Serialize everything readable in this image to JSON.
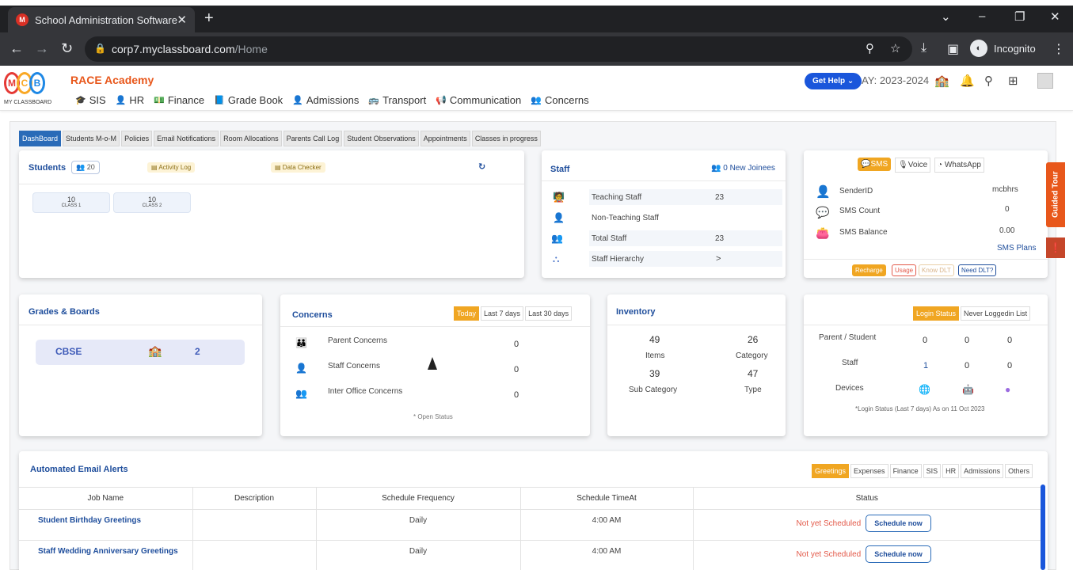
{
  "browser": {
    "tab_title": "School Administration Software",
    "url_host": "corp7.myclassboard.com",
    "url_path": "/Home",
    "incognito_label": "Incognito"
  },
  "app": {
    "school_name": "RACE Academy",
    "logo_letters": [
      "M",
      "C",
      "B"
    ],
    "logo_caption": "MY CLASSBOARD",
    "nav": [
      {
        "label": "SIS",
        "icon": "graduation-cap-icon"
      },
      {
        "label": "HR",
        "icon": "person-icon"
      },
      {
        "label": "Finance",
        "icon": "money-icon"
      },
      {
        "label": "Grade Book",
        "icon": "book-icon"
      },
      {
        "label": "Admissions",
        "icon": "person-icon"
      },
      {
        "label": "Transport",
        "icon": "bus-icon"
      },
      {
        "label": "Communication",
        "icon": "megaphone-icon"
      },
      {
        "label": "Concerns",
        "icon": "people-icon"
      }
    ],
    "get_help": "Get Help",
    "academic_year": "AY: 2023-2024"
  },
  "subtabs": [
    "DashBoard",
    "Students M-o-M",
    "Policies",
    "Email Notifications",
    "Room Allocations",
    "Parents Call Log",
    "Student Observations",
    "Appointments",
    "Classes in progress"
  ],
  "students": {
    "title": "Students",
    "count": "20",
    "activity_log": "Activity Log",
    "data_checker": "Data Checker",
    "classes": [
      {
        "count": "10",
        "name": "CLASS 1"
      },
      {
        "count": "10",
        "name": "CLASS 2"
      }
    ]
  },
  "staff": {
    "title": "Staff",
    "new_joinees": "0 New Joinees",
    "rows": [
      {
        "label": "Teaching Staff",
        "value": "23"
      },
      {
        "label": "Non-Teaching Staff",
        "value": ""
      },
      {
        "label": "Total Staff",
        "value": "23"
      },
      {
        "label": "Staff Hierarchy",
        "value": ">"
      }
    ]
  },
  "sms": {
    "channels": [
      "SMS",
      "Voice",
      "WhatsApp"
    ],
    "rows": [
      {
        "label": "SenderID",
        "value": "mcbhrs"
      },
      {
        "label": "SMS Count",
        "value": "0"
      },
      {
        "label": "SMS Balance",
        "value": "0.00"
      }
    ],
    "plans_link": "SMS Plans",
    "actions": [
      "Recharge",
      "Usage",
      "Know DLT",
      "Need DLT?"
    ]
  },
  "guided_tour": "Guided Tour",
  "grades": {
    "title": "Grades & Boards",
    "board": "CBSE",
    "count": "2"
  },
  "concerns": {
    "title": "Concerns",
    "ranges": [
      "Today",
      "Last 7 days",
      "Last 30 days"
    ],
    "rows": [
      {
        "label": "Parent Concerns",
        "value": "0"
      },
      {
        "label": "Staff Concerns",
        "value": "0"
      },
      {
        "label": "Inter Office Concerns",
        "value": "0"
      }
    ],
    "footnote": "* Open Status"
  },
  "inventory": {
    "title": "Inventory",
    "items_value": "49",
    "items_label": "Items",
    "category_value": "26",
    "category_label": "Category",
    "subcat_value": "39",
    "subcat_label": "Sub Category",
    "type_value": "47",
    "type_label": "Type"
  },
  "login": {
    "toggles": [
      "Login Status",
      "Never Loggedin List"
    ],
    "rows": [
      {
        "label": "Parent / Student",
        "values": [
          "0",
          "0",
          "0"
        ]
      },
      {
        "label": "Staff",
        "values": [
          "1",
          "0",
          "0"
        ]
      }
    ],
    "devices_label": "Devices",
    "footnote": "*Login Status (Last 7 days) As on 11 Oct 2023"
  },
  "email_alerts": {
    "title": "Automated Email Alerts",
    "filters": [
      "Greetings",
      "Expenses",
      "Finance",
      "SIS",
      "HR",
      "Admissions",
      "Others"
    ],
    "headers": [
      "Job Name",
      "Description",
      "Schedule Frequency",
      "Schedule TimeAt",
      "Status"
    ],
    "rows": [
      {
        "job": "Student Birthday Greetings",
        "description": "",
        "frequency": "Daily",
        "time": "4:00 AM",
        "status": "Not yet Scheduled",
        "action": "Schedule now"
      },
      {
        "job": "Staff Wedding Anniversary Greetings",
        "description": "",
        "frequency": "Daily",
        "time": "4:00 AM",
        "status": "Not yet Scheduled",
        "action": "Schedule now"
      }
    ]
  }
}
